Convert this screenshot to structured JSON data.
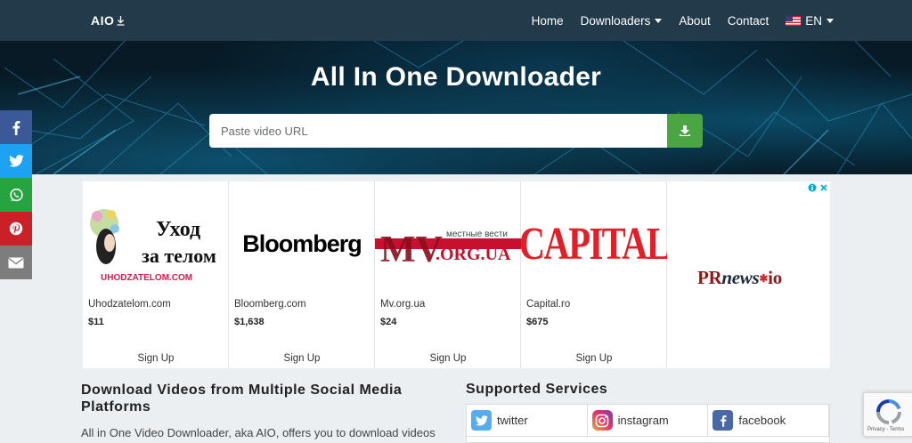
{
  "navbar": {
    "brand": "AIO",
    "brand_icon": "download-arrow-icon",
    "items": [
      {
        "label": "Home"
      },
      {
        "label": "Downloaders"
      },
      {
        "label": "About"
      },
      {
        "label": "Contact"
      },
      {
        "label": "EN"
      }
    ]
  },
  "hero": {
    "title": "All In One Downloader",
    "search_placeholder": "Paste video URL",
    "search_value": "",
    "download_button_icon": "download-icon"
  },
  "social": [
    {
      "name": "facebook",
      "color": "#3b5998"
    },
    {
      "name": "twitter",
      "color": "#1da1f2"
    },
    {
      "name": "whatsapp",
      "color": "#25a43f"
    },
    {
      "name": "pinterest",
      "color": "#cb2027"
    },
    {
      "name": "email",
      "color": "#7d7d7d"
    }
  ],
  "ad": {
    "cards": [
      {
        "logo_text": "Уход за телом",
        "logo_sub": "UHODZATELOM.COM",
        "site": "Uhodzatelom.com",
        "price": "$11",
        "cta": "Sign Up"
      },
      {
        "logo_text": "Bloomberg",
        "site": "Bloomberg.com",
        "price": "$1,638",
        "cta": "Sign Up"
      },
      {
        "logo_text": "MV.ORG.UA",
        "logo_sub": "местные вести",
        "site": "Mv.org.ua",
        "price": "$24",
        "cta": "Sign Up"
      },
      {
        "logo_text": "CAPITAL",
        "site": "Capital.ro",
        "price": "$675",
        "cta": "Sign Up"
      }
    ],
    "brand_pr": "PR",
    "brand_news": "news",
    "brand_io": "io"
  },
  "content": {
    "left_title": "Download Videos from Multiple Social Media Platforms",
    "left_text": "All in One Video Downloader, aka AIO, offers you to download videos",
    "right_title": "Supported Services",
    "services": [
      {
        "label": "twitter",
        "icon": "twitter-icon",
        "color": "#55acee"
      },
      {
        "label": "instagram",
        "icon": "instagram-icon",
        "color": "#c13584"
      },
      {
        "label": "facebook",
        "icon": "facebook-icon",
        "color": "#4a67a6"
      }
    ]
  },
  "recaptcha": {
    "text": "Privacy - Terms"
  }
}
